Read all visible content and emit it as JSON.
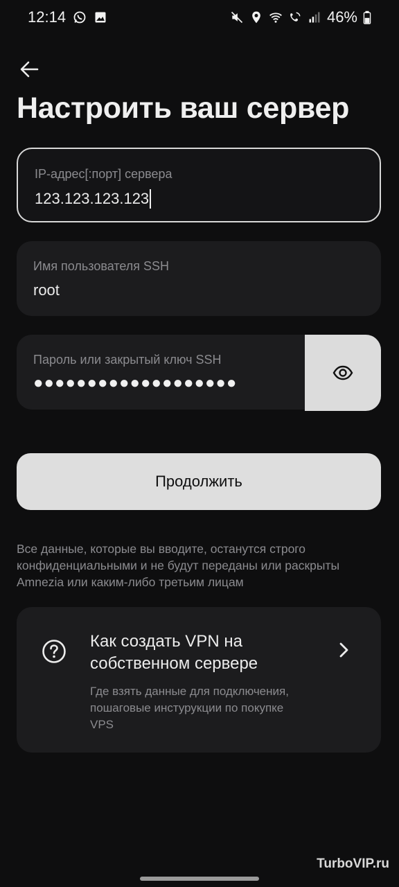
{
  "status_bar": {
    "time": "12:14",
    "battery": "46%",
    "left_icons": [
      "whatsapp-icon",
      "image-icon"
    ],
    "right_icons": [
      "mute-icon",
      "location-icon",
      "wifi-icon",
      "wifi-call-icon",
      "signal-icon",
      "battery-icon"
    ]
  },
  "page": {
    "title": "Настроить ваш сервер"
  },
  "fields": {
    "ip": {
      "label": "IP-адрес[:порт] сервера",
      "value": "123.123.123.123"
    },
    "username": {
      "label": "Имя пользователя SSH",
      "value": "root"
    },
    "password": {
      "label": "Пароль или закрытый ключ SSH",
      "value": "●●●●●●●●●●●●●●●●●●●"
    }
  },
  "buttons": {
    "continue_label": "Продолжить"
  },
  "disclaimer": "Все данные, которые вы вводите, останутся строго конфиденциальными и не будут переданы или раскрыты Amnezia или каким-либо третьим лицам",
  "help_card": {
    "title": "Как создать VPN на собственном сервере",
    "description": "Где взять данные для подключения, пошаговые инстурукции по покупке VPS"
  },
  "watermark": "TurboVIP.ru",
  "colors": {
    "background": "#0e0e0f",
    "surface": "#1c1c1e",
    "accent_button": "#dedede",
    "muted_text": "#8b8b8f"
  }
}
